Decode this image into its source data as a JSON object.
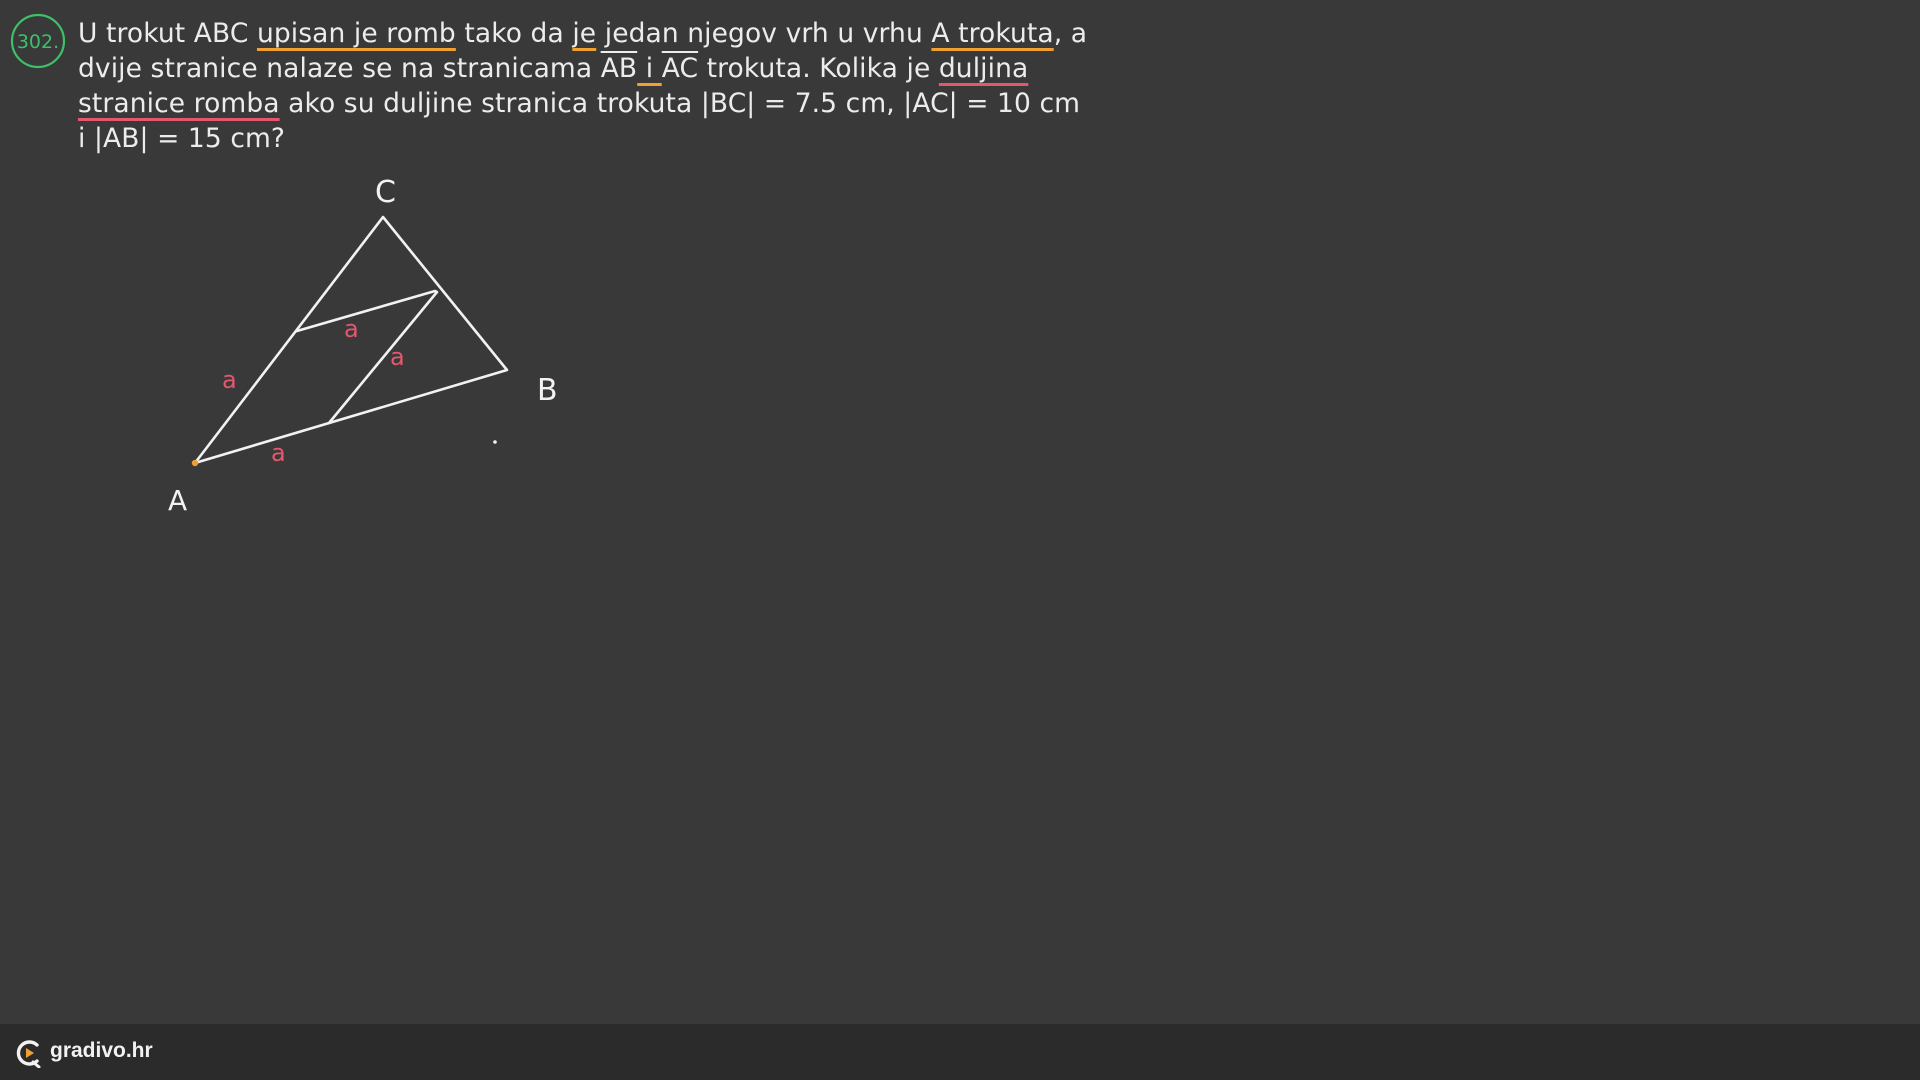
{
  "problem": {
    "number": "302.",
    "segments": [
      {
        "text": "U trokut ABC ",
        "style": "plain"
      },
      {
        "text": "upisan je romb",
        "style": "underline-orange"
      },
      {
        "text": " tako da ",
        "style": "plain"
      },
      {
        "text": "je",
        "style": "underline-orange"
      },
      {
        "text": " jedan njegov vrh u vrhu ",
        "style": "plain"
      },
      {
        "text": "A trokuta",
        "style": "underline-orange"
      },
      {
        "text": ", a dvije stranice nalaze se na stranicama ",
        "style": "plain"
      },
      {
        "text": "AB",
        "style": "overline-underline-orange"
      },
      {
        "text": " i ",
        "style": "underline-orange"
      },
      {
        "text": "AC",
        "style": "overline-underline-orange"
      },
      {
        "text": " trokuta. Kolika je ",
        "style": "plain"
      },
      {
        "text": "duljina stranice romba",
        "style": "underline-red"
      },
      {
        "text": " ako su duljine stranica trokuta |BC| = 7.5 cm, |AC| = 10 cm i |AB| = 15 cm?",
        "style": "plain"
      }
    ]
  },
  "figure": {
    "vertex_labels": {
      "a": "A",
      "b": "B",
      "c": "C"
    },
    "side_label": "a",
    "colors": {
      "lines": "#f2f2f2",
      "side_labels": "#e4576e",
      "vertex_a_dot": "#f0a030"
    }
  },
  "footer": {
    "brand": "gradivo.hr",
    "logo_icon": "gradivo-logo-icon"
  },
  "colors": {
    "background": "#393939",
    "footer_background": "#2b2b2b",
    "badge": "#3fbf6a",
    "underline_orange": "#f0a030",
    "underline_red": "#e4576e"
  }
}
